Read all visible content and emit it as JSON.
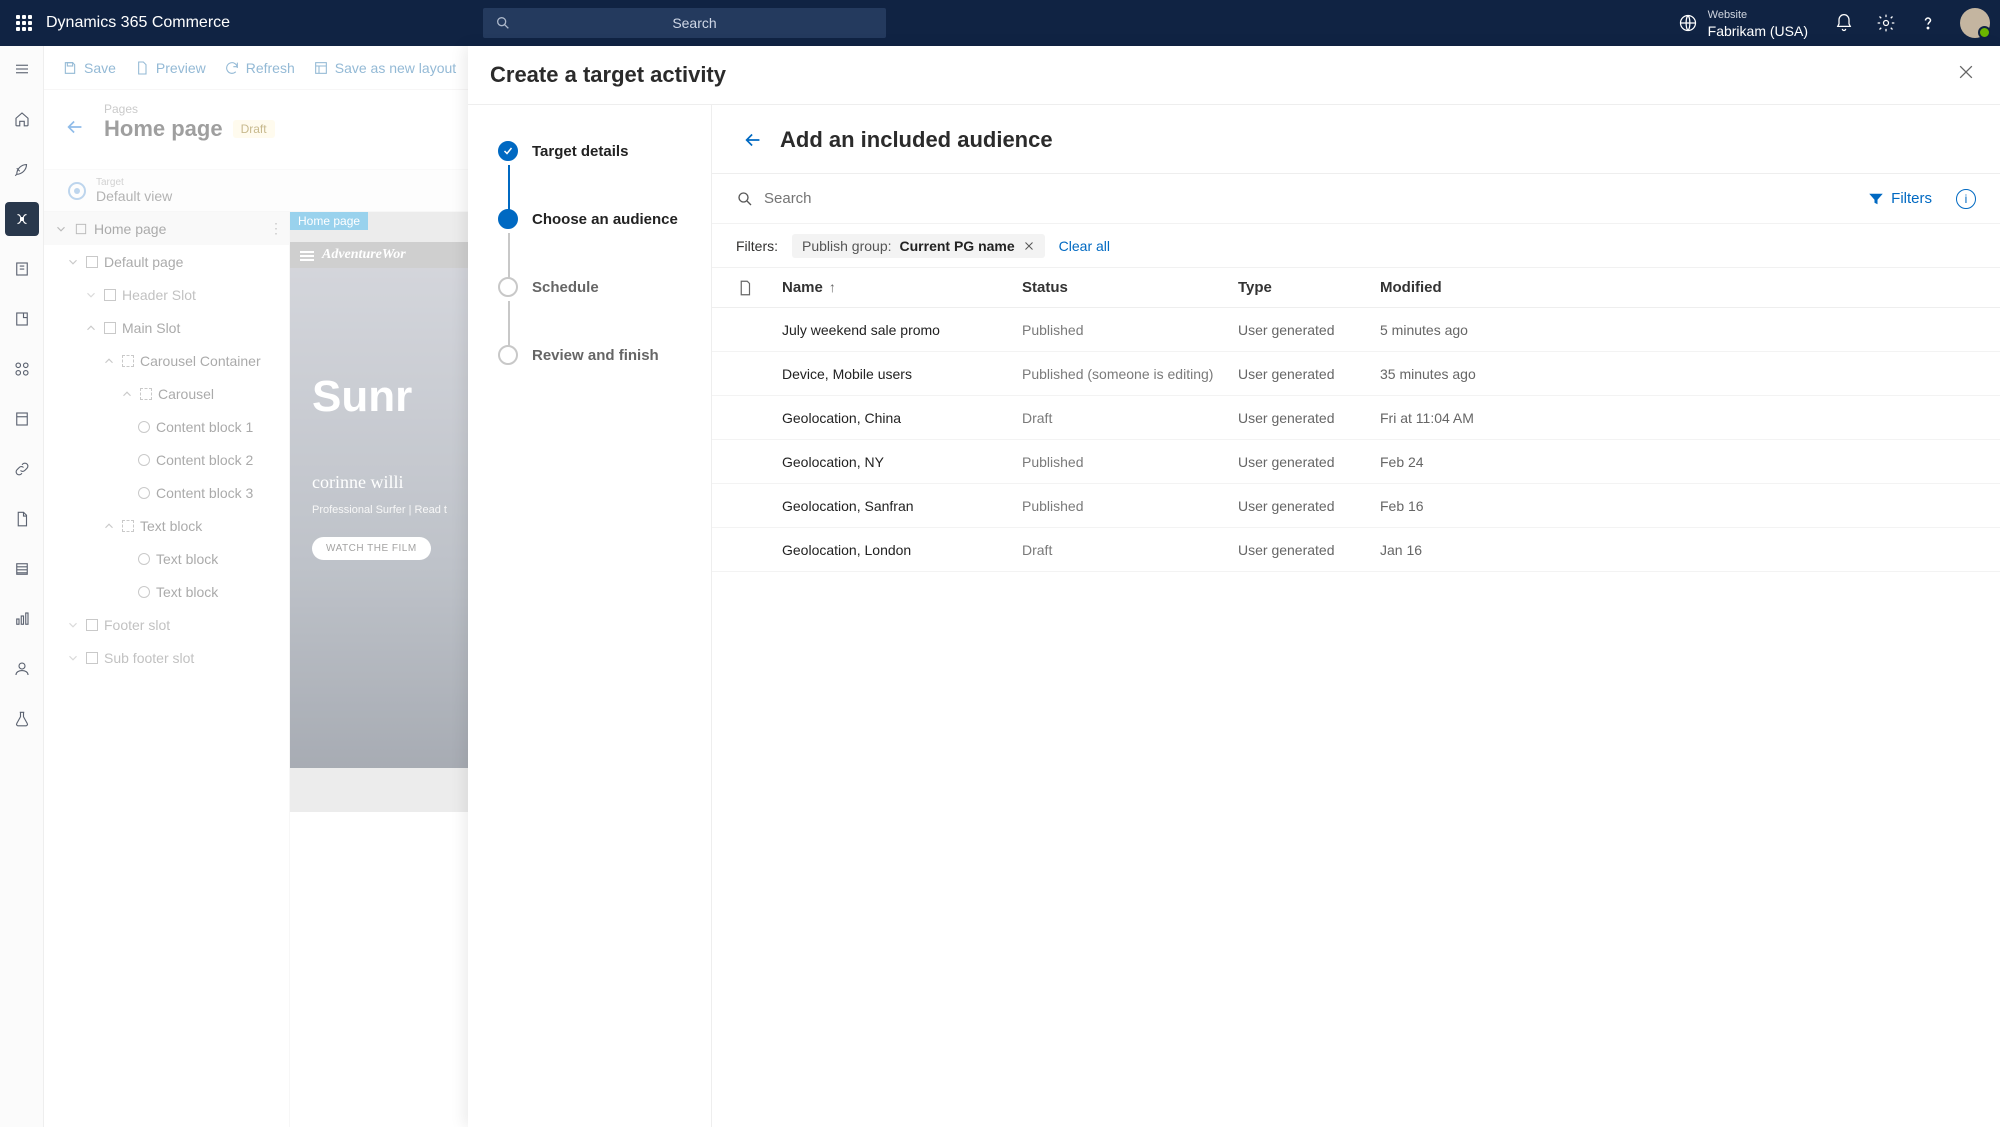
{
  "header": {
    "appTitle": "Dynamics 365 Commerce",
    "searchPlaceholder": "Search",
    "websiteLabel": "Website",
    "websiteValue": "Fabrikam (USA)"
  },
  "commands": {
    "save": "Save",
    "preview": "Preview",
    "refresh": "Refresh",
    "saveAsLayout": "Save as new layout"
  },
  "page": {
    "breadcrumb": "Pages",
    "title": "Home page",
    "status": "Draft",
    "targetLabel": "Target",
    "targetValue": "Default view"
  },
  "tree": {
    "homePage": "Home page",
    "defaultPage": "Default page",
    "headerSlot": "Header Slot",
    "mainSlot": "Main Slot",
    "carouselContainer": "Carousel Container",
    "carousel": "Carousel",
    "cb1": "Content block 1",
    "cb2": "Content block 2",
    "cb3": "Content block 3",
    "textBlock": "Text block",
    "textBlock1": "Text block",
    "textBlock2": "Text block",
    "footerSlot": "Footer slot",
    "subFooter": "Sub footer slot"
  },
  "canvas": {
    "tag": "Home page",
    "brand": "AdventureWor",
    "heroTitle": "Sunr",
    "signature": "corinne willi",
    "roleLine": "Professional Surfer   |   Read t",
    "watchBtn": "WATCH THE FILM"
  },
  "flyout": {
    "title": "Create a target activity",
    "steps": {
      "targetDetails": "Target details",
      "chooseAudience": "Choose an audience",
      "schedule": "Schedule",
      "review": "Review and finish"
    },
    "audiencePanel": {
      "title": "Add an included audience",
      "searchPlaceholder": "Search",
      "filtersBtn": "Filters",
      "filtersLabel": "Filters:",
      "chipLabel": "Publish group:",
      "chipValue": "Current PG name",
      "clearAll": "Clear all",
      "columns": {
        "name": "Name",
        "status": "Status",
        "type": "Type",
        "modified": "Modified"
      },
      "rows": [
        {
          "name": "July weekend sale promo",
          "status": "Published",
          "type": "User generated",
          "modified": "5 minutes ago"
        },
        {
          "name": "Device, Mobile users",
          "status": "Published (someone is editing)",
          "type": "User generated",
          "modified": "35 minutes ago"
        },
        {
          "name": "Geolocation, China",
          "status": "Draft",
          "type": "User generated",
          "modified": "Fri at 11:04 AM"
        },
        {
          "name": "Geolocation, NY",
          "status": "Published",
          "type": "User generated",
          "modified": "Feb 24"
        },
        {
          "name": "Geolocation, Sanfran",
          "status": "Published",
          "type": "User generated",
          "modified": "Feb 16"
        },
        {
          "name": "Geolocation, London",
          "status": "Draft",
          "type": "User generated",
          "modified": "Jan 16"
        }
      ]
    }
  }
}
